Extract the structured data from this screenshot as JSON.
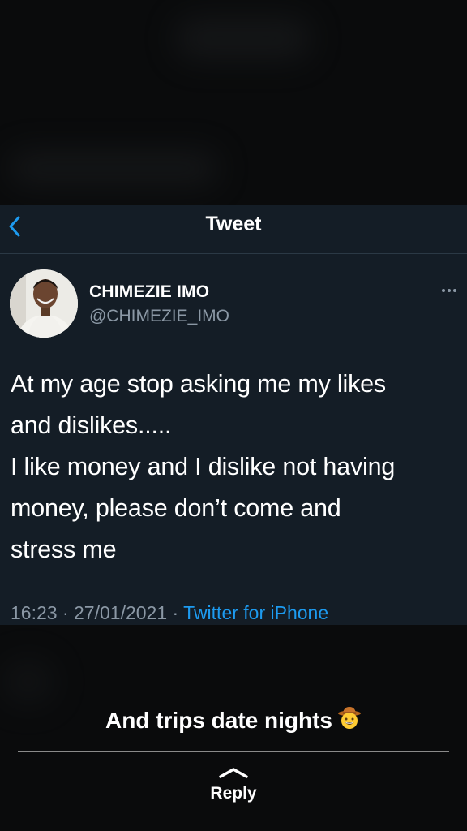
{
  "header": {
    "title": "Tweet"
  },
  "tweet": {
    "author_name": "CHIMEZIE IMO",
    "author_handle": "@CHIMEZIE_IMO",
    "text": "At my age stop asking me my likes\nand dislikes.....\nI like money and I dislike not having\nmoney, please don’t come and\nstress me",
    "time": "16:23",
    "date": "27/01/2021",
    "separator": " · ",
    "source": "Twitter for iPhone"
  },
  "story": {
    "caption": "And trips date nights",
    "caption_emoji": "cowboy-face-emoji",
    "reply_label": "Reply"
  },
  "colors": {
    "card_background": "#141d26",
    "accent_link": "#1d9bf0",
    "muted_text": "#8b98a5",
    "primary_text": "#ffffff"
  },
  "icons": [
    "back-chevron-icon",
    "more-dots-icon",
    "reply-chevron-up-icon"
  ]
}
